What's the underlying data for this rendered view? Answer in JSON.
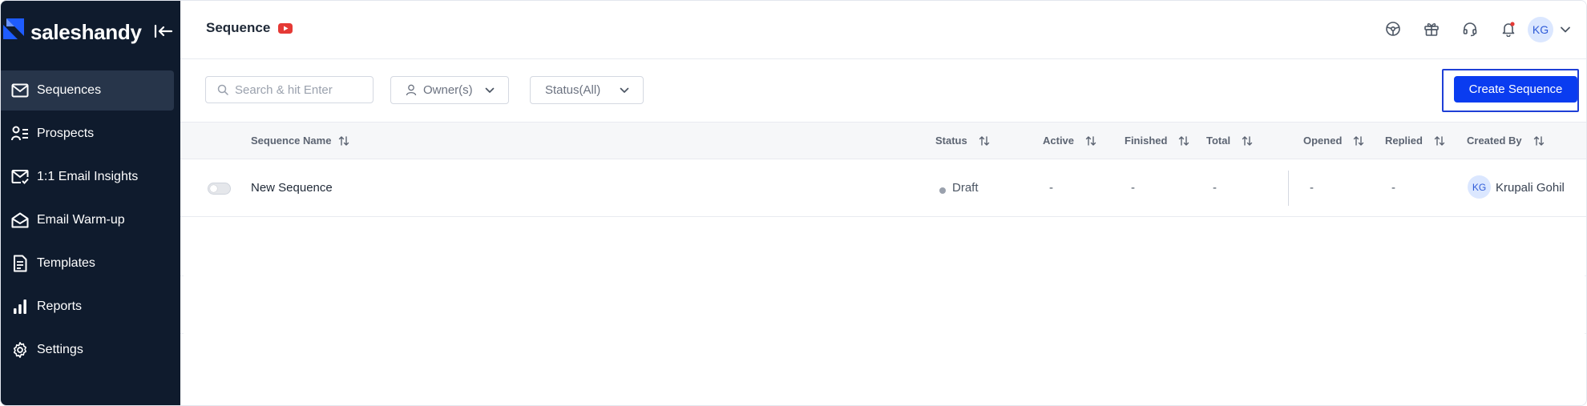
{
  "app": {
    "brand_name": "saleshandy",
    "colors": {
      "sidebar_bg": "#0f1b2d",
      "sidebar_active": "#27354a",
      "primary": "#0a3cf0",
      "accent_red": "#e53935"
    }
  },
  "sidebar": {
    "collapse_icon": "collapse-left-icon",
    "items": [
      {
        "label": "Sequences",
        "icon": "mail-icon",
        "active": true
      },
      {
        "label": "Prospects",
        "icon": "prospects-icon",
        "active": false
      },
      {
        "label": "1:1 Email Insights",
        "icon": "mail-check-icon",
        "active": false
      },
      {
        "label": "Email Warm-up",
        "icon": "mail-open-icon",
        "active": false
      },
      {
        "label": "Templates",
        "icon": "document-icon",
        "active": false
      },
      {
        "label": "Reports",
        "icon": "bar-chart-icon",
        "active": false
      },
      {
        "label": "Settings",
        "icon": "gear-icon",
        "active": false
      }
    ]
  },
  "header": {
    "title": "Sequence",
    "title_icon": "youtube-icon",
    "icons": [
      "steering-wheel-icon",
      "gift-icon",
      "headset-icon",
      "bell-icon"
    ],
    "user_initials": "KG"
  },
  "filters": {
    "search_placeholder": "Search & hit Enter",
    "owner_label": "Owner(s)",
    "status_label": "Status(All)",
    "create_button": "Create Sequence"
  },
  "table": {
    "columns": [
      "Sequence Name",
      "Status",
      "Active",
      "Finished",
      "Total",
      "Opened",
      "Replied",
      "Created By"
    ],
    "rows": [
      {
        "name": "New Sequence",
        "status": "Draft",
        "active": "-",
        "finished": "-",
        "total": "-",
        "opened": "-",
        "replied": "-",
        "created_by_initials": "KG",
        "created_by": "Krupali Gohil"
      }
    ]
  }
}
